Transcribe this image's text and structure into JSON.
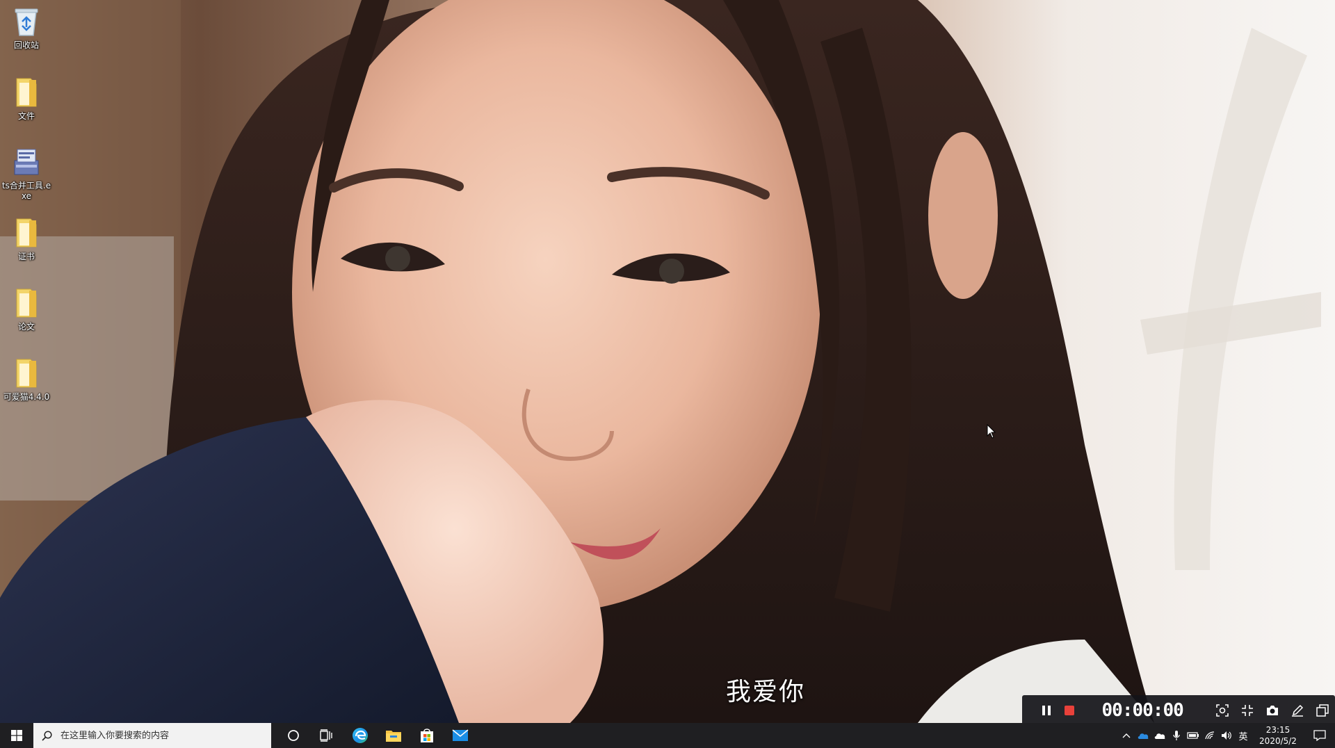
{
  "desktop": {
    "icons": [
      {
        "label": "回收站",
        "icon": "recycle-bin-icon"
      },
      {
        "label": "文件",
        "icon": "folder-icon"
      },
      {
        "label": "ts合并工具.exe",
        "icon": "installer-icon"
      },
      {
        "label": "证书",
        "icon": "folder-icon"
      },
      {
        "label": "论文",
        "icon": "folder-icon"
      },
      {
        "label": "可爱猫4.4.0",
        "icon": "folder-icon"
      }
    ]
  },
  "subtitle": "我爱你",
  "recorder": {
    "timer": "00:00:00",
    "colors": {
      "stop": "#e8413a",
      "bar": "#141418"
    }
  },
  "taskbar": {
    "search_placeholder": "在这里输入你要搜索的内容",
    "pinned": [
      "cortana-icon",
      "task-view-icon",
      "edge-icon",
      "file-explorer-icon",
      "store-icon",
      "mail-icon"
    ],
    "tray": {
      "ime_label": "英",
      "time": "23:15",
      "date": "2020/5/2"
    },
    "colors": {
      "taskbar": "#1f1f22",
      "search": "#f2f2f2"
    }
  }
}
